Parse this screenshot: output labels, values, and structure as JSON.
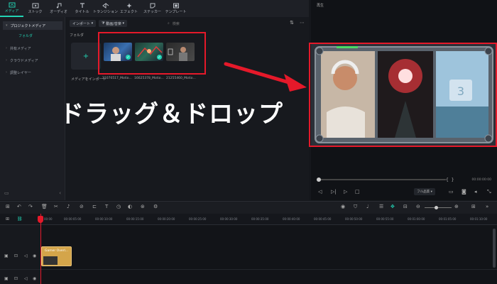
{
  "toolbar": {
    "items": [
      {
        "label": "メディア",
        "icon": "media-icon"
      },
      {
        "label": "ストック",
        "icon": "stock-icon"
      },
      {
        "label": "オーディオ",
        "icon": "audio-icon"
      },
      {
        "label": "タイトル",
        "icon": "title-icon"
      },
      {
        "label": "トランジション",
        "icon": "transition-icon"
      },
      {
        "label": "エフェクト",
        "icon": "effect-icon"
      },
      {
        "label": "ステッカー",
        "icon": "sticker-icon"
      },
      {
        "label": "テンプレート",
        "icon": "template-icon"
      }
    ]
  },
  "sidebar": {
    "items": [
      {
        "label": "プロジェクトメディア"
      },
      {
        "label": "フォルダ"
      },
      {
        "label": "共有メディア"
      },
      {
        "label": "クラウドメディア"
      },
      {
        "label": "調整レイヤー"
      }
    ]
  },
  "media": {
    "import_dropdown": "インポート",
    "filter_dropdown": "動画/音楽",
    "search_placeholder": "検索",
    "folder_label": "フォルダ",
    "import_tile_label": "メディアをインポート",
    "files": [
      {
        "name": "21070517_Motio..."
      },
      {
        "name": "16625378_Motio..."
      },
      {
        "name": "21255460_Motio..."
      }
    ]
  },
  "overlay_text": "ドラッグ＆ドロップ",
  "player": {
    "title": "再生",
    "time": "00:00:00:00",
    "quality": "フル品質"
  },
  "timeline": {
    "ticks": [
      "00:00",
      "00:00:05:00",
      "00:00:10:00",
      "00:00:15:00",
      "00:00:20:00",
      "00:00:25:00",
      "00:00:30:00",
      "00:00:35:00",
      "00:00:40:00",
      "00:00:45:00",
      "00:00:50:00",
      "00:00:55:00",
      "00:01:00:00",
      "00:01:05:00",
      "00:01:10:00"
    ],
    "clip_label": "Gamer Overl..."
  },
  "colors": {
    "accent": "#22d3b4",
    "highlight": "#e5192a",
    "clip": "#d4a54a"
  }
}
